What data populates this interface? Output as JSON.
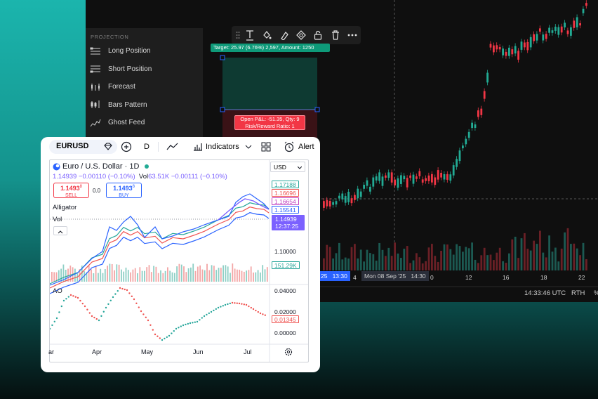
{
  "projection": {
    "header": "PROJECTION",
    "items": [
      {
        "label": "Long Position",
        "icon": "long-position-icon"
      },
      {
        "label": "Short Position",
        "icon": "short-position-icon"
      },
      {
        "label": "Forecast",
        "icon": "forecast-icon"
      },
      {
        "label": "Bars Pattern",
        "icon": "bars-pattern-icon"
      },
      {
        "label": "Ghost Feed",
        "icon": "ghost-feed-icon"
      }
    ]
  },
  "drawing_toolbar": {
    "icons": [
      "drag-handle-icon",
      "text-icon",
      "fill-color-icon",
      "line-color-icon",
      "visibility-icon",
      "lock-icon",
      "trash-icon",
      "more-icon"
    ]
  },
  "position_labels": {
    "target": "Target: 25.97 (6.76%) 2,597, Amount: 1250",
    "pnl_line1": "Open P&L: -51.35, Qty: 9",
    "pnl_line2": "Risk/Reward Ratio: 1"
  },
  "bg_chart": {
    "date_labels": [
      "25",
      "13:30",
      "4",
      "Mon 08 Sep '25",
      "14:30",
      "0",
      "12",
      "16",
      "18",
      "22"
    ],
    "time": "14:33:46 UTC",
    "session": "RTH",
    "percent": "%"
  },
  "card": {
    "symbol": "EURUSD",
    "interval": "D",
    "indicators_label": "Indicators",
    "alert_label": "Alert",
    "title": "Euro / U.S. Dollar · 1D",
    "currency": "USD",
    "ohlc": "1.14939  −0.00110 (−0.10%)",
    "vol_label": "Vol",
    "vol_value": "63.51K  −0.00111 (−0.10%)",
    "sell_price": "1.1493",
    "sell_sup": "8",
    "sell_label": "SELL",
    "spread": "0.0",
    "buy_price": "1.1493",
    "buy_sup": "8",
    "buy_label": "BUY",
    "alligator_label": "Alligator",
    "vol_pane_label": "Vol",
    "ao_label": "AO",
    "price_scale": {
      "p1": "1.17188",
      "p2": "1.16696",
      "p3": "1.16654",
      "p4": "1.15541",
      "last": "1.14939",
      "countdown": "12:37:25",
      "level": "1.10000",
      "vol": "151.29K"
    },
    "ao_scale": {
      "a1": "0.04000",
      "a2": "0.02000",
      "a_last": "0.01345",
      "a3": "0.00000"
    },
    "months": [
      "ar",
      "Apr",
      "May",
      "Jun",
      "Jul"
    ],
    "colors": {
      "sell": "#f23645",
      "buy": "#2962ff",
      "up": "#26a69a",
      "down": "#ef5350",
      "price": "#2962ff"
    }
  }
}
